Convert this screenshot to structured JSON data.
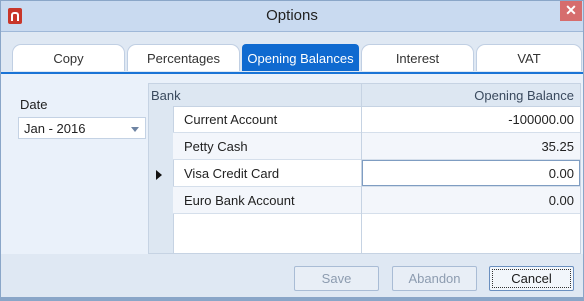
{
  "window": {
    "title": "Options",
    "close_label": "✕"
  },
  "tabs": [
    {
      "label": "Copy",
      "active": false
    },
    {
      "label": "Percentages",
      "active": false
    },
    {
      "label": "Opening Balances",
      "active": true
    },
    {
      "label": "Interest",
      "active": false
    },
    {
      "label": "VAT",
      "active": false
    }
  ],
  "date": {
    "label": "Date",
    "value": "Jan - 2016"
  },
  "grid": {
    "columns": {
      "bank": "Bank",
      "opening_balance": "Opening Balance"
    },
    "rows": [
      {
        "bank": "Current Account",
        "balance": "-100000.00"
      },
      {
        "bank": "Petty Cash",
        "balance": "35.25"
      },
      {
        "bank": "Visa Credit Card",
        "balance": "0.00",
        "current": true
      },
      {
        "bank": "Euro Bank Account",
        "balance": "0.00"
      }
    ]
  },
  "buttons": {
    "save": "Save",
    "abandon": "Abandon",
    "cancel": "Cancel"
  },
  "colors": {
    "accent": "#0f6ad0",
    "title_bar": "#c9daf0",
    "close": "#d66d6d"
  }
}
